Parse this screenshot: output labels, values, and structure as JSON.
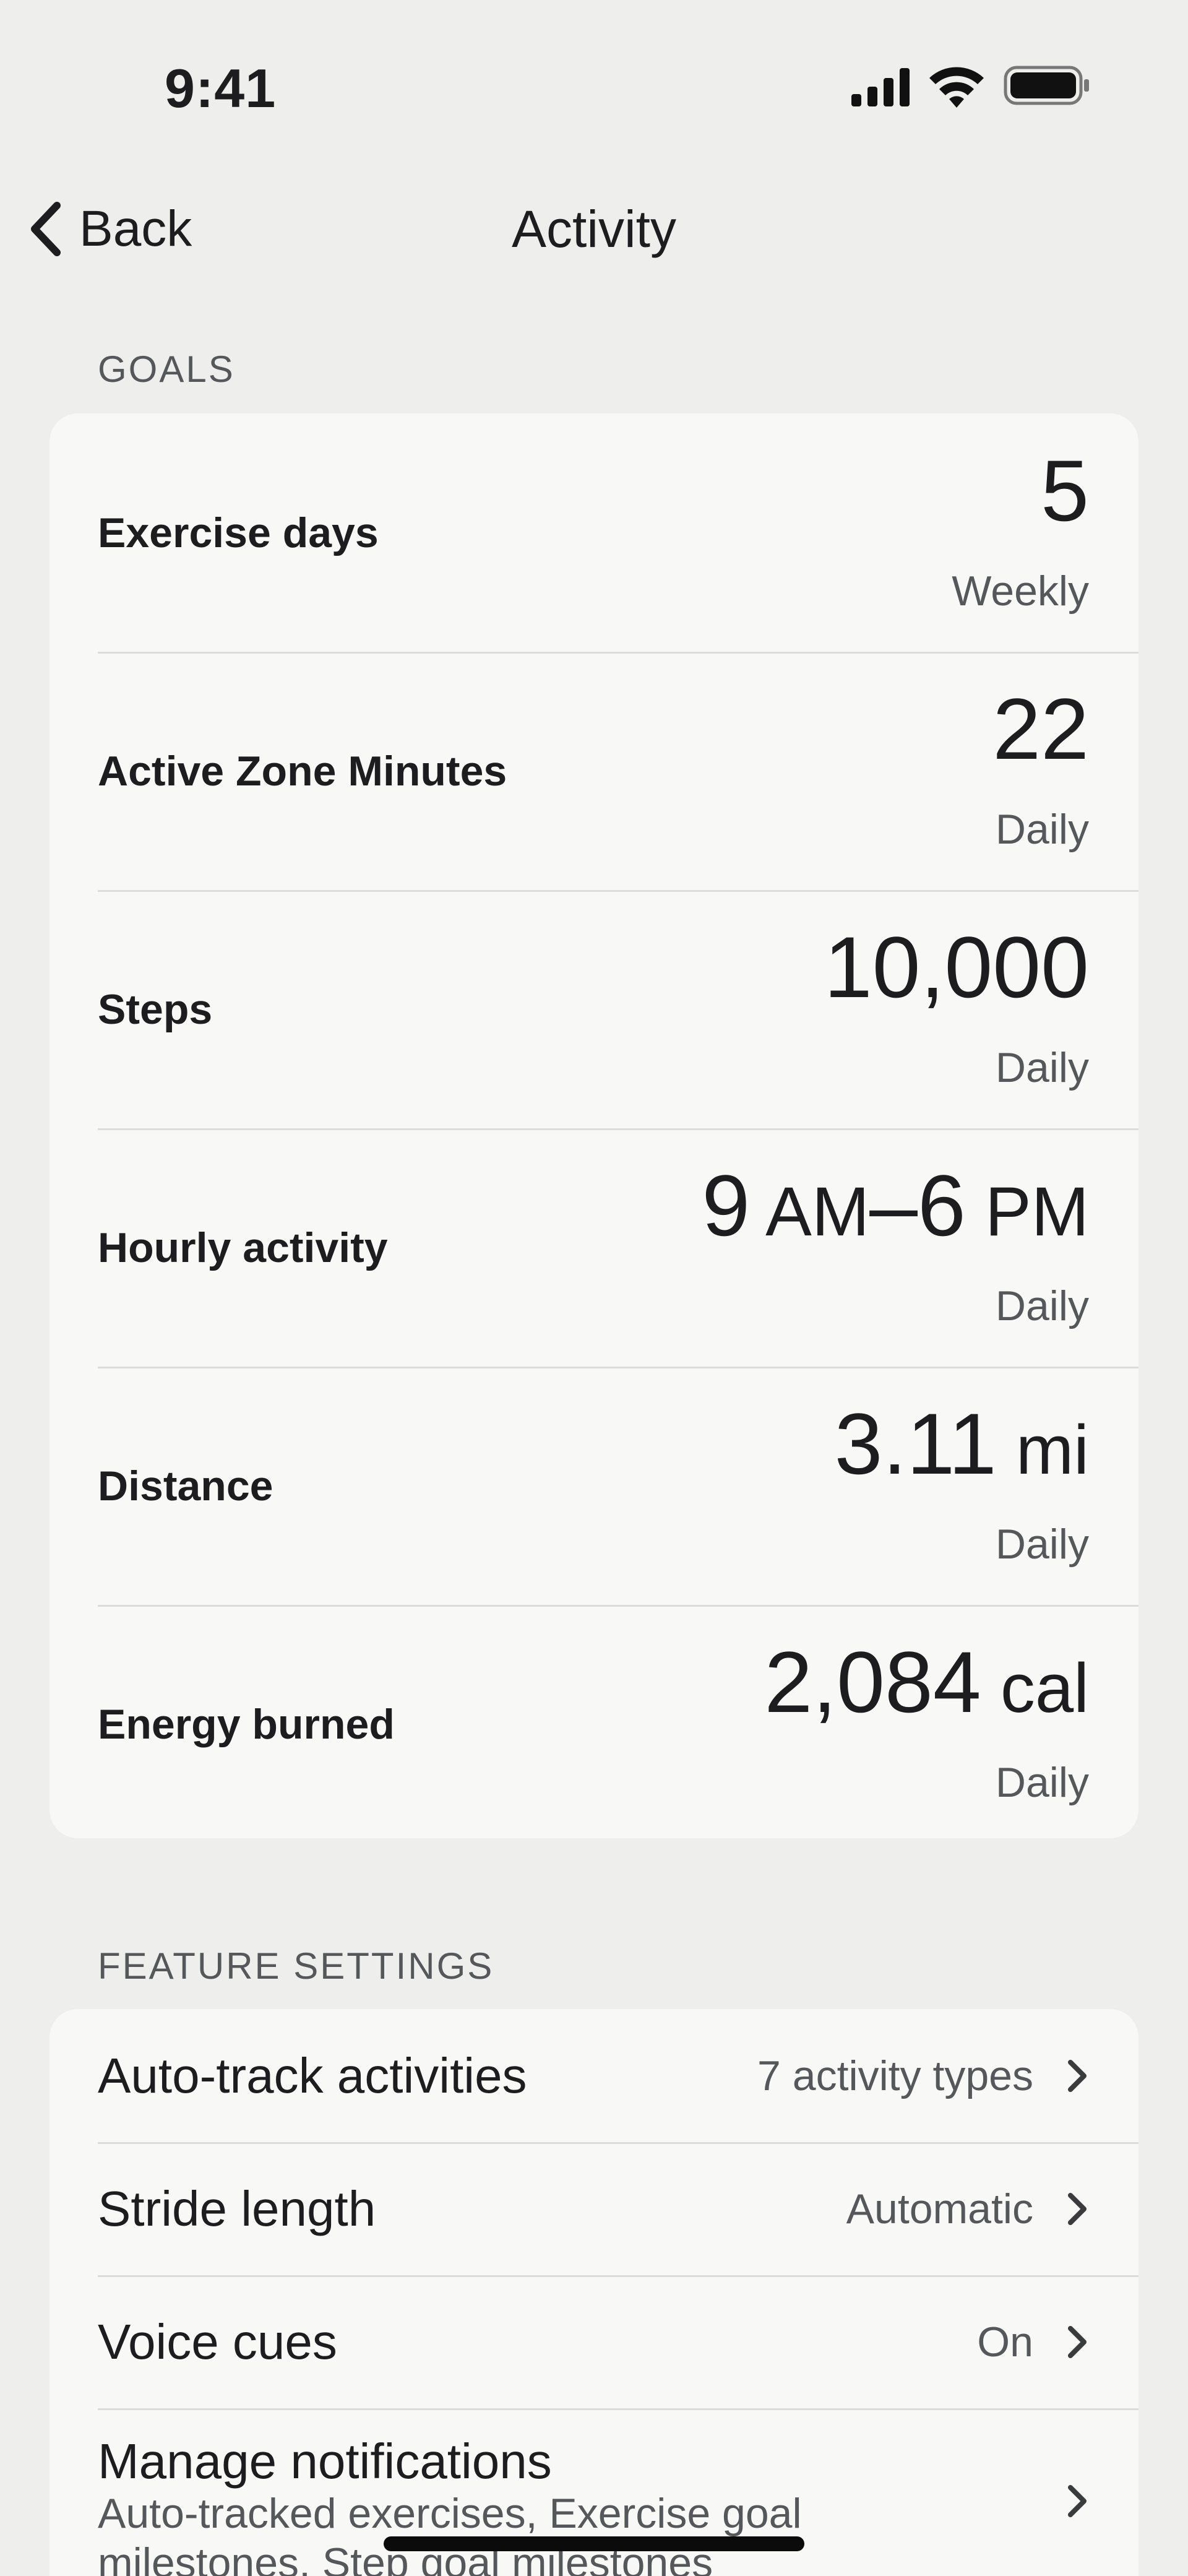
{
  "status_bar": {
    "time": "9:41",
    "signal_icon": "cellular-signal-icon",
    "wifi_icon": "wifi-icon",
    "battery_icon": "battery-icon"
  },
  "nav": {
    "back_label": "Back",
    "back_icon": "chevron-left-icon",
    "title": "Activity"
  },
  "goals": {
    "section_label": "GOALS",
    "rows": [
      {
        "label": "Exercise days",
        "value": "5",
        "unit": "",
        "period": "Weekly"
      },
      {
        "label": "Active Zone Minutes",
        "value": "22",
        "unit": "",
        "period": "Daily"
      },
      {
        "label": "Steps",
        "value": "10,000",
        "unit": "",
        "period": "Daily"
      },
      {
        "label": "Hourly activity",
        "value_parts": [
          "9",
          " AM",
          "–6",
          " PM"
        ],
        "period": "Daily"
      },
      {
        "label": "Distance",
        "value": "3.11",
        "unit": " mi",
        "period": "Daily"
      },
      {
        "label": "Energy burned",
        "value": "2,084",
        "unit": " cal",
        "period": "Daily"
      }
    ]
  },
  "feature_settings": {
    "section_label": "FEATURE SETTINGS",
    "rows": [
      {
        "label": "Auto-track activities",
        "value": "7 activity types"
      },
      {
        "label": "Stride length",
        "value": "Automatic"
      },
      {
        "label": "Voice cues",
        "value": "On"
      },
      {
        "label": "Manage notifications",
        "sublabel": "Auto-tracked exercises, Exercise goal milestones, Step goal milestones"
      }
    ]
  },
  "colors": {
    "background": "#eeefed",
    "card": "#f8f9f7",
    "primary_text": "#1d1d1f",
    "secondary_text": "#55575a",
    "divider": "#dcdddb"
  }
}
